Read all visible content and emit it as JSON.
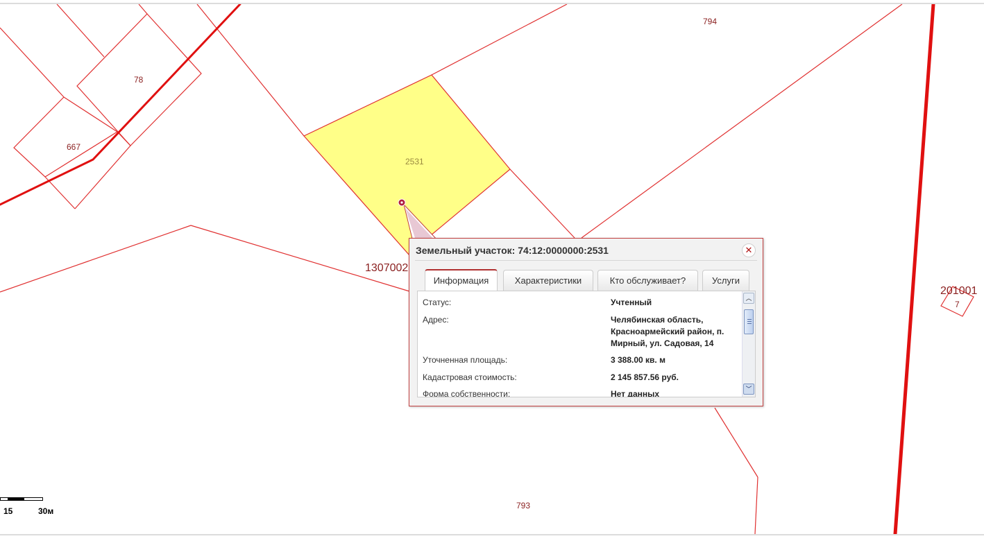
{
  "map": {
    "parcel_labels": [
      "794",
      "78",
      "667",
      "2531",
      "793"
    ],
    "quarter_labels": [
      "1307002",
      "201001",
      "7"
    ],
    "colors": {
      "boundary": "#e03030",
      "main_boundary": "#e01010",
      "selected_fill": "#ffff88",
      "label": "#8a1f1f",
      "marker": "#b02040"
    },
    "scale": {
      "tick_labels": [
        "15",
        "30м"
      ]
    }
  },
  "popup": {
    "title": "Земельный участок: 74:12:0000000:2531",
    "close_icon": "close-icon",
    "tabs": [
      {
        "label": "Информация",
        "active": true
      },
      {
        "label": "Характеристики",
        "active": false
      },
      {
        "label": "Кто обслуживает?",
        "active": false
      },
      {
        "label": "Услуги",
        "active": false
      }
    ],
    "rows": [
      {
        "label": "Статус:",
        "value": "Учтенный"
      },
      {
        "label": "Адрес:",
        "value": "Челябинская область, Красноармейский район, п. Мирный, ул. Садовая, 14"
      },
      {
        "label": "Уточненная площадь:",
        "value": "3 388.00 кв. м"
      },
      {
        "label": "Кадастровая стоимость:",
        "value": "2 145 857.56 руб."
      },
      {
        "label": "Форма собственности:",
        "value": "Нет данных"
      }
    ]
  }
}
